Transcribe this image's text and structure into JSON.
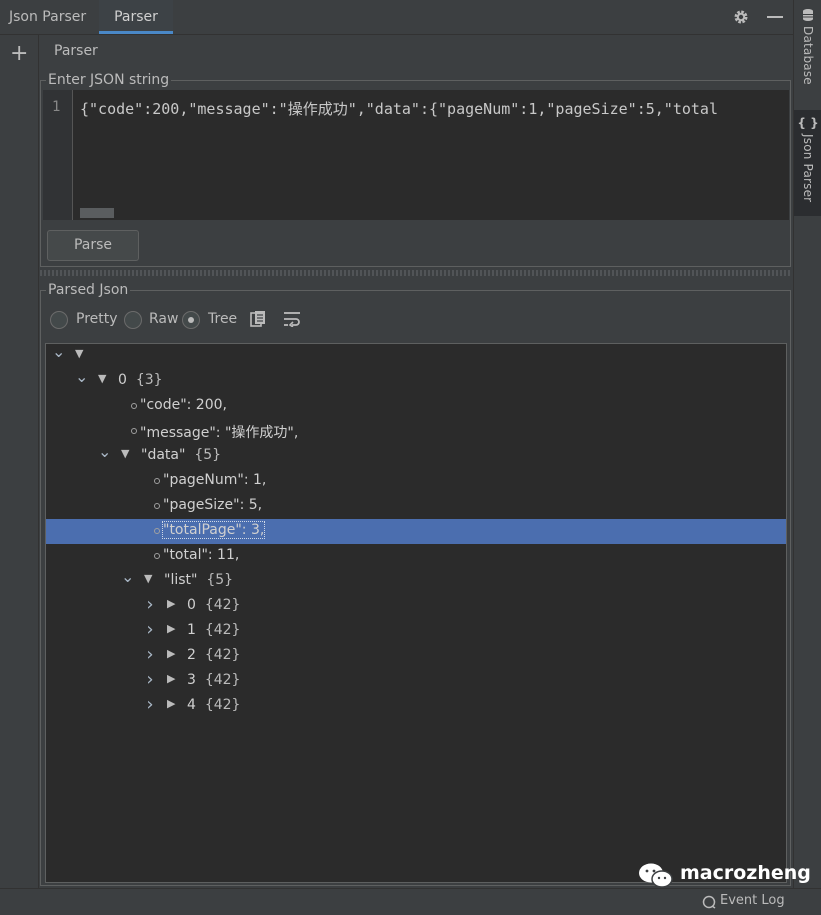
{
  "header": {
    "title": "Json Parser",
    "tab_label": "Parser"
  },
  "left_toolbar": {
    "add_symbol": "+"
  },
  "content_tab": "Parser",
  "right_stripe": {
    "database_label": "Database",
    "json_parser_label": "Json Parser",
    "json_parser_icon_text": "{ }"
  },
  "input_section": {
    "title": "Enter JSON string",
    "line_number": "1",
    "code": "{\"code\":200,\"message\":\"操作成功\",\"data\":{\"pageNum\":1,\"pageSize\":5,\"total",
    "parse_button": "Parse"
  },
  "output_section": {
    "title": "Parsed Json",
    "view_modes": [
      {
        "label": "Pretty",
        "checked": false
      },
      {
        "label": "Raw",
        "checked": false
      },
      {
        "label": "Tree",
        "checked": true
      }
    ]
  },
  "tree": [
    {
      "level": 0,
      "kind": "node",
      "expanded": true,
      "key": "",
      "count": ""
    },
    {
      "level": 1,
      "kind": "node",
      "expanded": true,
      "key": "0",
      "count": "{3}"
    },
    {
      "level": 2,
      "kind": "leaf",
      "text": "\"code\": 200,"
    },
    {
      "level": 2,
      "kind": "leaf",
      "text": "\"message\": \"操作成功\","
    },
    {
      "level": 2,
      "kind": "node",
      "expanded": true,
      "key": "\"data\"",
      "count": "{5}"
    },
    {
      "level": 3,
      "kind": "leaf",
      "text": "\"pageNum\": 1,"
    },
    {
      "level": 3,
      "kind": "leaf",
      "text": "\"pageSize\": 5,"
    },
    {
      "level": 3,
      "kind": "leaf",
      "text": "\"totalPage\": 3,",
      "selected": true
    },
    {
      "level": 3,
      "kind": "leaf",
      "text": "\"total\": 11,"
    },
    {
      "level": 3,
      "kind": "node",
      "expanded": true,
      "key": "\"list\"",
      "count": "{5}"
    },
    {
      "level": 4,
      "kind": "node",
      "expanded": false,
      "key": "0",
      "count": "{42}"
    },
    {
      "level": 4,
      "kind": "node",
      "expanded": false,
      "key": "1",
      "count": "{42}"
    },
    {
      "level": 4,
      "kind": "node",
      "expanded": false,
      "key": "2",
      "count": "{42}"
    },
    {
      "level": 4,
      "kind": "node",
      "expanded": false,
      "key": "3",
      "count": "{42}"
    },
    {
      "level": 4,
      "kind": "node",
      "expanded": false,
      "key": "4",
      "count": "{42}"
    }
  ],
  "status_bar": {
    "event_log": "Event Log"
  },
  "watermark": "macrozheng",
  "colors": {
    "background": "#3c3f41",
    "editor_background": "#2b2b2b",
    "accent": "#4a88c7",
    "selection": "#4b6eaf"
  }
}
